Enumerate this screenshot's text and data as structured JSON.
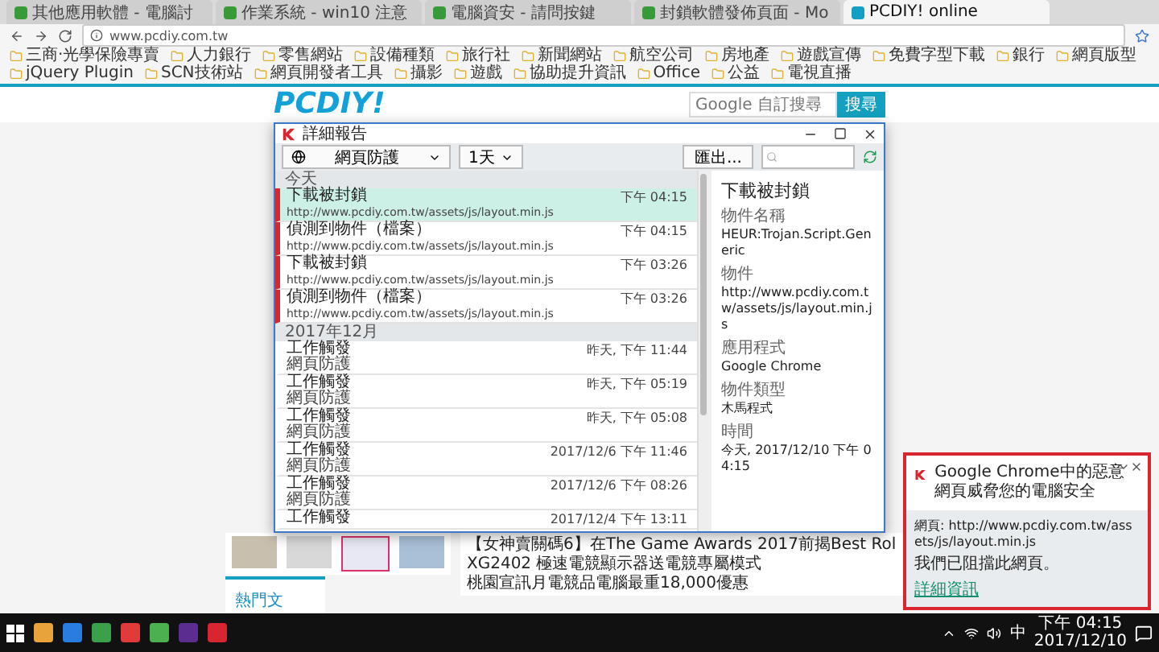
{
  "browser": {
    "tabs": [
      {
        "title": "其他應用軟體 - 電腦討",
        "selected": false
      },
      {
        "title": "作業系統 - win10 注意",
        "selected": false
      },
      {
        "title": "電腦資安 - 請問按鍵",
        "selected": false
      },
      {
        "title": "封鎖軟體發佈頁面 - Mo",
        "selected": false
      },
      {
        "title": "PCDIY! online",
        "selected": true
      }
    ],
    "url": "www.pcdiy.com.tw",
    "bookmarks": [
      "三商‧光學保險專賣",
      "人力銀行",
      "零售網站",
      "設備種類",
      "旅行社",
      "新聞網站",
      "航空公司",
      "房地產",
      "遊戲宣傳",
      "免費字型下載",
      "銀行",
      "網頁版型",
      "jQuery Plugin",
      "SCN技術站",
      "網頁開發者工具",
      "攝影",
      "遊戲",
      "協助提升資訊",
      "Office",
      "公益",
      "電視直播"
    ]
  },
  "page": {
    "logo": "PCDIY!",
    "search_placeholder": "Google 自訂搜尋",
    "search_button": "搜尋",
    "headlines": [
      "【女神賣關碼6】在The Game Awards 2017前揭Best Rol",
      "XG2402 極速電競顯示器送電競專屬模式",
      "桃園宣訊月電競品電腦最重18,000優惠"
    ],
    "section_tab": "熱門文"
  },
  "dialog": {
    "title": "詳細報告",
    "filter": "網頁防護",
    "period": "1天",
    "export_button": "匯出...",
    "groups": [
      {
        "label": "今天",
        "events": [
          {
            "title": "下載被封鎖",
            "detail": "http://www.pcdiy.com.tw/assets/js/layout.min.js",
            "time": "下午 04:15",
            "kind": "threat",
            "selected": true
          },
          {
            "title": "偵測到物件（檔案）",
            "detail": "http://www.pcdiy.com.tw/assets/js/layout.min.js",
            "time": "下午 04:15",
            "kind": "threat",
            "selected": false
          },
          {
            "title": "下載被封鎖",
            "detail": "http://www.pcdiy.com.tw/assets/js/layout.min.js",
            "time": "下午 03:26",
            "kind": "threat",
            "selected": false
          },
          {
            "title": "偵測到物件（檔案）",
            "detail": "http://www.pcdiy.com.tw/assets/js/layout.min.js",
            "time": "下午 03:26",
            "kind": "threat",
            "selected": false
          }
        ]
      },
      {
        "label": "2017年12月",
        "events": [
          {
            "title": "工作觸發",
            "detail": "網頁防護",
            "time": "昨天, 下午 11:44",
            "kind": "info",
            "selected": false
          },
          {
            "title": "工作觸發",
            "detail": "網頁防護",
            "time": "昨天, 下午 05:19",
            "kind": "info",
            "selected": false
          },
          {
            "title": "工作觸發",
            "detail": "網頁防護",
            "time": "昨天, 下午 05:08",
            "kind": "info",
            "selected": false
          },
          {
            "title": "工作觸發",
            "detail": "網頁防護",
            "time": "2017/12/6 下午 11:46",
            "kind": "info",
            "selected": false
          },
          {
            "title": "工作觸發",
            "detail": "網頁防護",
            "time": "2017/12/6 下午 08:26",
            "kind": "info",
            "selected": false
          },
          {
            "title": "工作觸發",
            "time": "2017/12/4 下午 13:11",
            "kind": "info",
            "selected": false
          }
        ]
      }
    ],
    "details": {
      "title": "下載被封鎖",
      "fields": [
        {
          "label": "物件名稱",
          "value": "HEUR:Trojan.Script.Generic"
        },
        {
          "label": "物件",
          "value": "http://www.pcdiy.com.tw/assets/js/layout.min.js"
        },
        {
          "label": "應用程式",
          "value": "Google Chrome"
        },
        {
          "label": "物件類型",
          "value": "木馬程式"
        },
        {
          "label": "時間",
          "value": "今天, 2017/12/10 下午 04:15"
        }
      ]
    }
  },
  "notification": {
    "title": "Google Chrome中的惡意網頁威脅您的電腦安全",
    "page_line": "網頁: http://www.pcdiy.com.tw/assets/js/layout.min.js",
    "message": "我們已阻擋此網頁。",
    "link": "詳細資訊"
  },
  "taskbar": {
    "ime": "中",
    "time": "下午 04:15",
    "date": "2017/12/10"
  }
}
